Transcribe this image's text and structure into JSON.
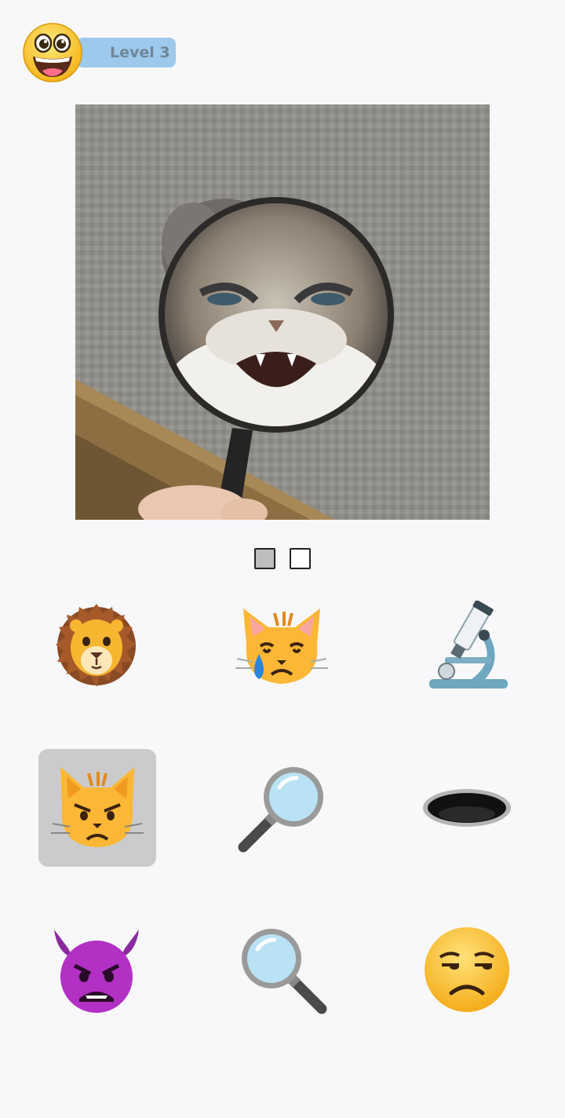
{
  "header": {
    "level_label": "Level 3",
    "avatar_icon": "grinning-face-icon"
  },
  "puzzle": {
    "image_icon": "angry-cat-magnifying-glass-photo",
    "answer_slots": [
      {
        "state": "filled"
      },
      {
        "state": "empty"
      }
    ]
  },
  "choices": [
    {
      "icon": "lion-face-icon",
      "selected": false
    },
    {
      "icon": "crying-cat-icon",
      "selected": false
    },
    {
      "icon": "microscope-icon",
      "selected": false
    },
    {
      "icon": "pouting-cat-icon",
      "selected": true
    },
    {
      "icon": "magnifying-glass-left-icon",
      "selected": false
    },
    {
      "icon": "hole-icon",
      "selected": false
    },
    {
      "icon": "angry-devil-icon",
      "selected": false
    },
    {
      "icon": "magnifying-glass-right-icon",
      "selected": false
    },
    {
      "icon": "unamused-face-icon",
      "selected": false
    }
  ],
  "colors": {
    "background": "#f8f8fa",
    "level_pill": "#9cc9ec",
    "level_text": "#6f8799",
    "selected_tile": "#cbcbcd",
    "slot_filled": "#bdbdbd"
  }
}
